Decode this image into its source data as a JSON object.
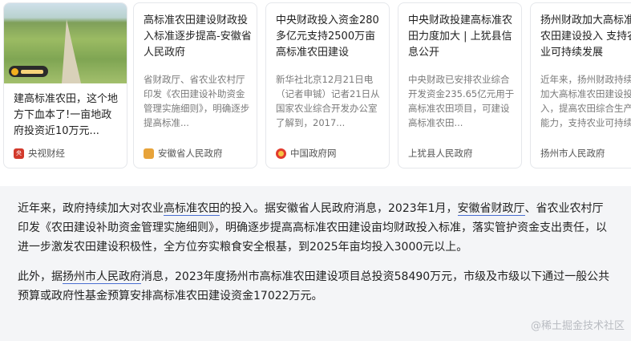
{
  "cards": [
    {
      "title": "建高标准农田，这个地方下血本了!一亩地政府投资近10万元...",
      "source": "央视财经",
      "source_icon": "cctv-icon"
    },
    {
      "title": "高标准农田建设财政投入标准逐步提高-安徽省人民政府",
      "snippet": "省财政厅、省农业农村厅印发《农田建设补助资金管理实施细则》，明确逐步提高标准...",
      "source": "安徽省人民政府",
      "source_icon": "anhui-gov-icon"
    },
    {
      "title": "中央财政投入资金280多亿元支持2500万亩高标准农田建设",
      "snippet": "新华社北京12月21日电（记者申铖）记者21日从国家农业综合开发办公室了解到，2017...",
      "source": "中国政府网",
      "source_icon": "gov-cn-icon"
    },
    {
      "title": "中央财政投建高标准农田力度加大 | 上犹县信息公开",
      "snippet": "中央财政已安排农业综合开发资金235.65亿元用于高标准农田项目，可建设高标准农田...",
      "source": "上犹县人民政府",
      "source_icon": ""
    },
    {
      "title": "扬州财政加大高标准农田建设投入 支持农业可持续发展",
      "snippet": "近年来，扬州财政持续加大高标准农田建设投入，提高农田综合生产能力，支持农业可持续...",
      "source": "扬州市人民政府",
      "source_icon": ""
    }
  ],
  "answer": {
    "p1_a": "近年来，政府持续加大对农业",
    "p1_link1": "高标准农田",
    "p1_b": "的投入。据安徽省人民政府消息，2023年1月，",
    "p1_link2": "安徽省财政厅",
    "p1_c": "、省农业农村厅印发《农田建设补助资金管理实施细则》，明确逐步提高高标准农田建设亩均财政投入标准，落实管护资金支出责任，以进一步激发农田建设积极性，全方位夯实粮食安全根基，到2025年亩均投入3000元以上。",
    "p2_a": "此外，据",
    "p2_link": "扬州市人民政府",
    "p2_b": "消息，2023年度扬州市高标准农田建设项目总投资58490万元，市级及市级以下通过一般公共预算或政府性基金预算安排高标准农田建设资金17022万元。"
  },
  "watermark": "@稀土掘金技术社区"
}
